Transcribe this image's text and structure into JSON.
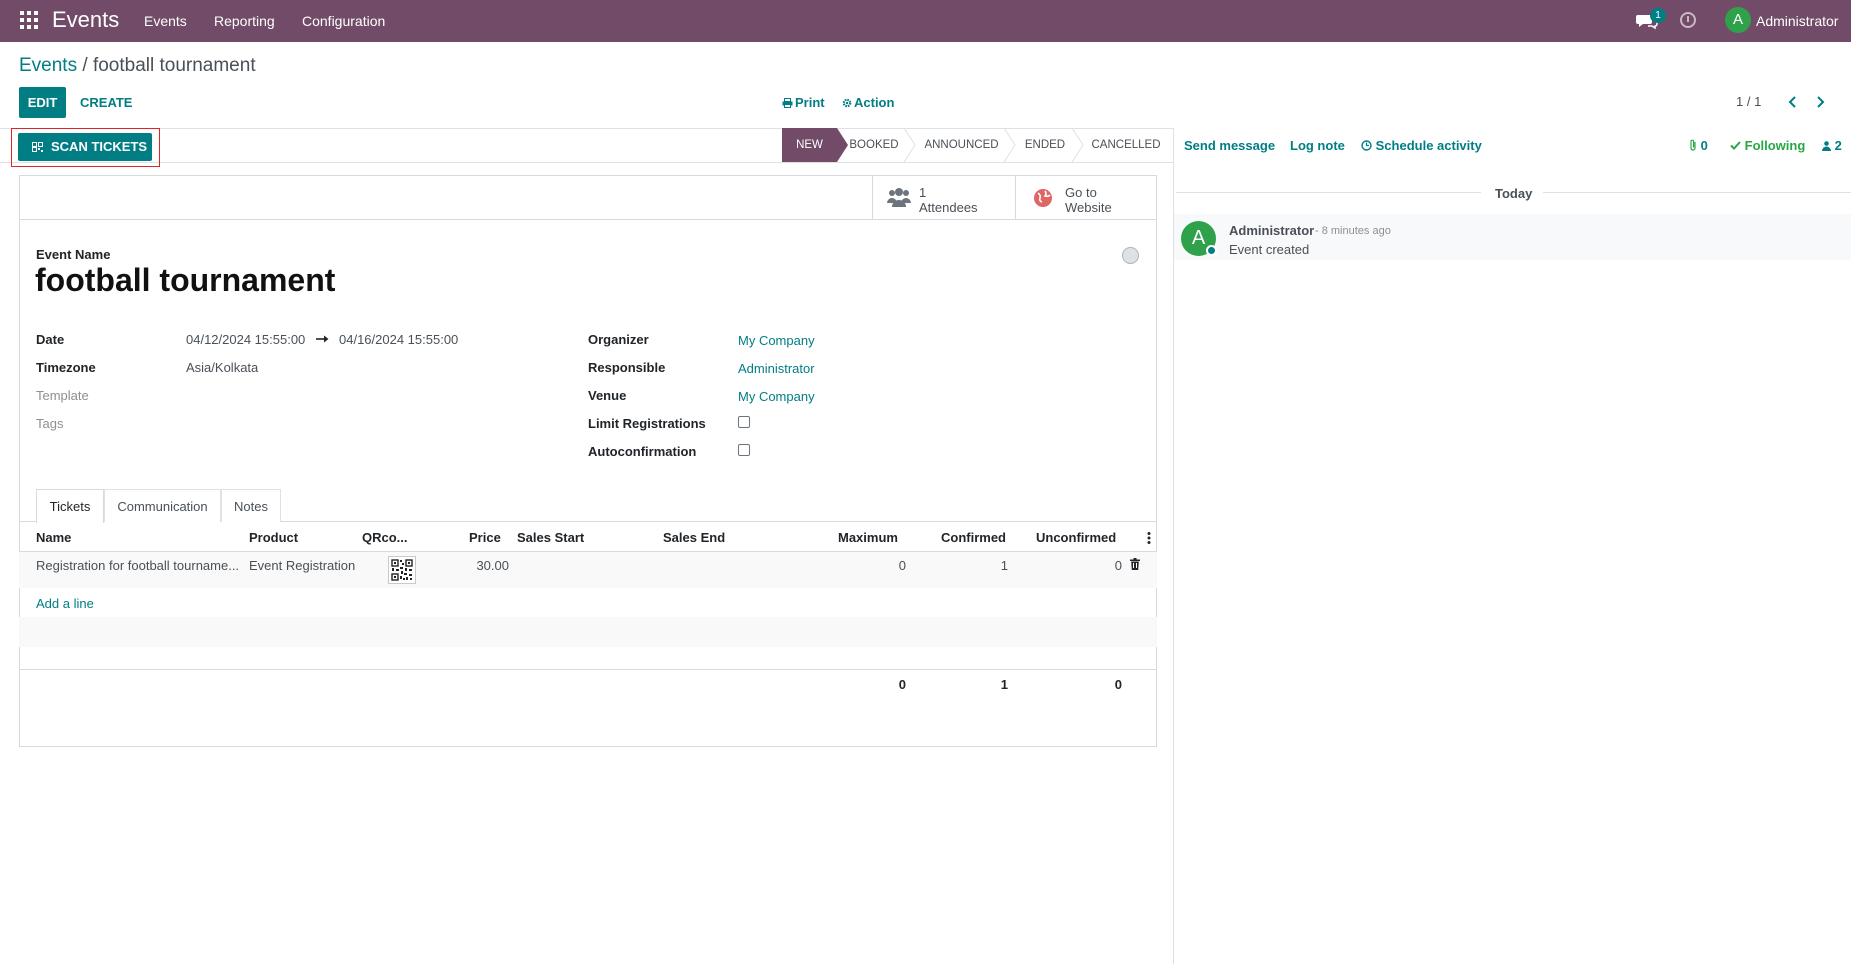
{
  "navbar": {
    "brand": "Events",
    "menus": [
      "Events",
      "Reporting",
      "Configuration"
    ],
    "chat_count": "1",
    "user_initial": "A",
    "user_name": "Administrator"
  },
  "control_panel": {
    "breadcrumb_parent": "Events",
    "breadcrumb_separator": "/",
    "breadcrumb_current": "football tournament",
    "edit_label": "EDIT",
    "create_label": "CREATE",
    "print_label": "Print",
    "action_label": "Action",
    "pager": "1 / 1"
  },
  "statusbar": {
    "scan_label": "SCAN TICKETS",
    "stages": [
      "NEW",
      "BOOKED",
      "ANNOUNCED",
      "ENDED",
      "CANCELLED"
    ],
    "active_stage": "NEW"
  },
  "smart_buttons": {
    "attendees_count": "1",
    "attendees_label": "Attendees",
    "website_line1": "Go to",
    "website_line2": "Website"
  },
  "form": {
    "name_label": "Event Name",
    "name": "football tournament",
    "left": {
      "date_label": "Date",
      "date_start": "04/12/2024 15:55:00",
      "date_end": "04/16/2024 15:55:00",
      "timezone_label": "Timezone",
      "timezone": "Asia/Kolkata",
      "template_label": "Template",
      "tags_label": "Tags"
    },
    "right": {
      "organizer_label": "Organizer",
      "organizer": "My Company",
      "responsible_label": "Responsible",
      "responsible": "Administrator",
      "venue_label": "Venue",
      "venue": "My Company",
      "limit_label": "Limit Registrations",
      "autoconfirm_label": "Autoconfirmation"
    }
  },
  "tabs": [
    "Tickets",
    "Communication",
    "Notes"
  ],
  "tickets": {
    "columns": [
      "Name",
      "Product",
      "QRco...",
      "Price",
      "Sales Start",
      "Sales End",
      "Maximum",
      "Confirmed",
      "Unconfirmed"
    ],
    "rows": [
      {
        "name": "Registration for football tourname...",
        "product": "Event Registration",
        "price": "30.00",
        "sales_start": "",
        "sales_end": "",
        "maximum": "0",
        "confirmed": "1",
        "unconfirmed": "0"
      }
    ],
    "add_line": "Add a line",
    "totals": {
      "maximum": "0",
      "confirmed": "1",
      "unconfirmed": "0"
    }
  },
  "chatter": {
    "send_message": "Send message",
    "log_note": "Log note",
    "schedule_activity": "Schedule activity",
    "attachments": "0",
    "following": "Following",
    "followers": "2",
    "date_separator": "Today",
    "messages": [
      {
        "initial": "A",
        "author": "Administrator",
        "time": "- 8 minutes ago",
        "body": "Event created"
      }
    ]
  },
  "colors": {
    "brand": "#714B67",
    "accent": "#017e84",
    "avatar": "#2fa14b",
    "highlight_frame": "#e02424",
    "following": "#28a745"
  }
}
